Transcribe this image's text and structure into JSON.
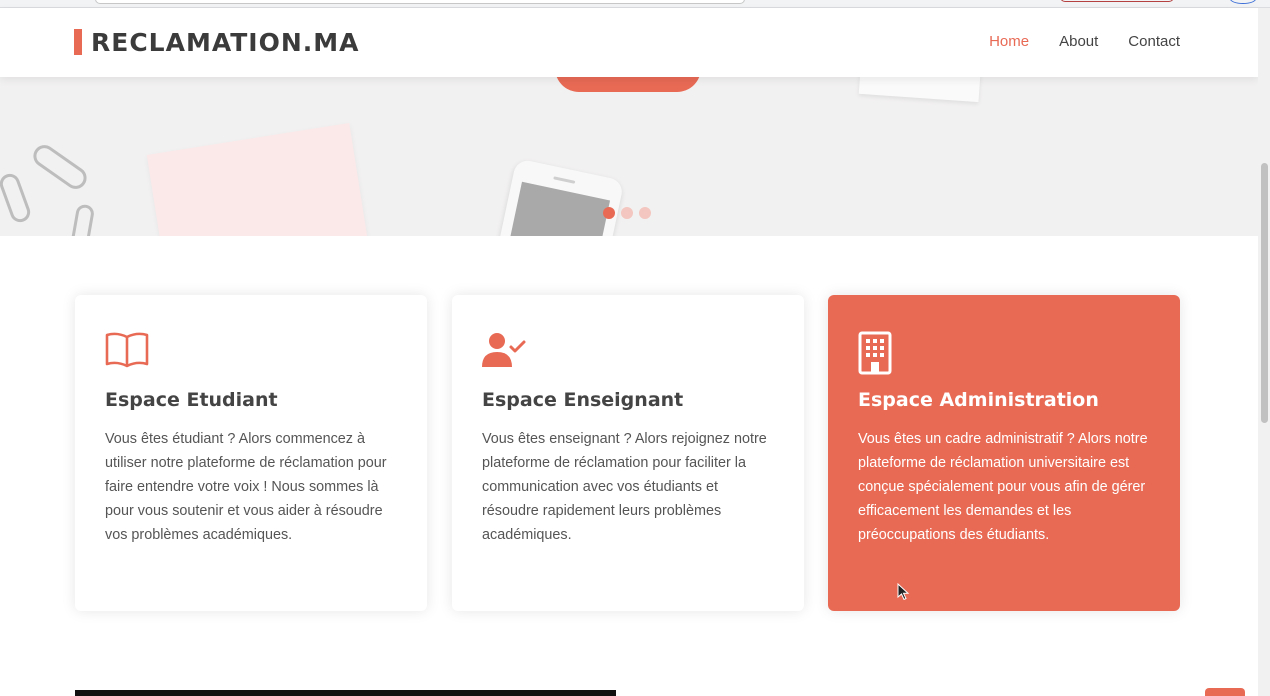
{
  "header": {
    "brand": "RECLAMATION.MA",
    "nav": [
      {
        "label": "Home",
        "active": true
      },
      {
        "label": "About",
        "active": false
      },
      {
        "label": "Contact",
        "active": false
      }
    ]
  },
  "hero": {
    "carousel": {
      "slides": 3,
      "active_index": 0
    }
  },
  "cards": [
    {
      "icon": "book-open-icon",
      "title": "Espace Etudiant",
      "text": "Vous êtes étudiant ? Alors commencez à utiliser notre plateforme de réclamation pour faire entendre votre voix ! Nous sommes là pour vous soutenir et vous aider à résoudre vos problèmes académiques."
    },
    {
      "icon": "user-check-icon",
      "title": "Espace Enseignant",
      "text": "Vous êtes enseignant ? Alors rejoignez notre plateforme de réclamation pour faciliter la communication avec vos étudiants et résoudre rapidement leurs problèmes académiques."
    },
    {
      "icon": "building-icon",
      "title": "Espace Administration",
      "text": "Vous êtes un cadre administratif ? Alors notre plateforme de réclamation universitaire est conçue spécialement pour vous afin de gérer efficacement les demandes et les préoccupations des étudiants."
    }
  ],
  "colors": {
    "accent": "#e86a55",
    "text": "#444444",
    "hero_bg": "#f2f1f1"
  }
}
